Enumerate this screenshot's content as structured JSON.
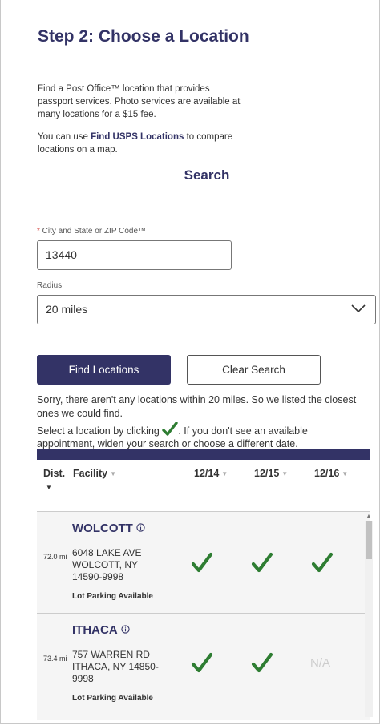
{
  "heading": {
    "title": "Step 2: Choose a Location",
    "intro": "Find a Post Office™ location that provides passport services. Photo services are available at many locations for a $15 fee.",
    "compare_prefix": "You can use ",
    "compare_link": "Find USPS Locations",
    "compare_suffix": " to compare locations on a map."
  },
  "search": {
    "heading": "Search",
    "city_label_required": "*",
    "city_label": " City and State or ZIP Code™",
    "city_value": "13440",
    "radius_label": "Radius",
    "radius_value": "20 miles",
    "find_button": "Find Locations",
    "clear_button": "Clear Search"
  },
  "messages": {
    "no_results": "Sorry, there aren't any locations within 20 miles. So we listed the closest ones we could find.",
    "select_prefix": "Select a location by clicking",
    "select_suffix": ". If you don't see an available appointment, widen your search or choose a different date."
  },
  "table": {
    "columns": [
      "Dist.",
      "Facility",
      "12/14",
      "12/15",
      "12/16"
    ],
    "rows": [
      {
        "distance": "72.0 mi",
        "name": "WOLCOTT",
        "address": "6048 LAKE AVE WOLCOTT, NY 14590-9998",
        "parking": "Lot Parking Available",
        "availability": [
          "check",
          "check",
          "check"
        ]
      },
      {
        "distance": "73.4 mi",
        "name": "ITHACA",
        "address": "757 WARREN RD ITHACA, NY 14850-9998",
        "parking": "Lot Parking Available",
        "availability": [
          "check",
          "check",
          "N/A"
        ]
      }
    ]
  },
  "colors": {
    "brand_navy": "#333366",
    "check_green": "#2e7d32",
    "na_gray": "#cccccc"
  },
  "icons": {
    "available": "check-icon",
    "info": "info-icon",
    "sort": "sort-icon",
    "select": "chevron-down-icon"
  }
}
